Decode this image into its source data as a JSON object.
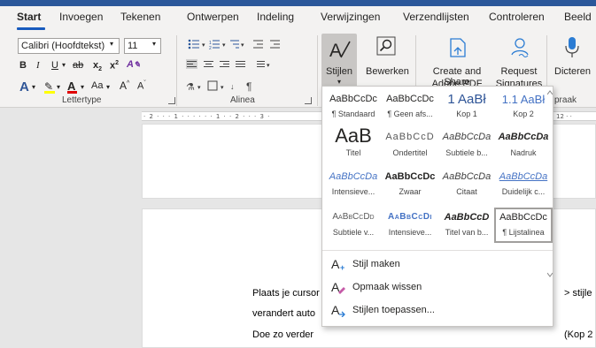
{
  "tabs": [
    "Start",
    "Invoegen",
    "Tekenen",
    "Ontwerpen",
    "Indeling",
    "Verwijzingen",
    "Verzendlijsten",
    "Controleren",
    "Beeld"
  ],
  "font": {
    "name": "Calibri (Hoofdtekst)",
    "size": "11",
    "increase": "A",
    "decrease": "A",
    "case": "Aa"
  },
  "format_buttons": {
    "bold": "B",
    "italic": "I",
    "underline": "U",
    "strike": "ab",
    "subscript": "x",
    "superscript": "x"
  },
  "groups": {
    "lettertype": "Lettertype",
    "alinea": "Alinea",
    "spraak_partial": "praak"
  },
  "buttons": {
    "stijlen": "Stijlen",
    "bewerken": "Bewerken",
    "create_share_1": "Create and Share",
    "create_share_2": "Adobe PDF",
    "request_1": "Request",
    "request_2": "Signatures",
    "dicteren": "Dicteren"
  },
  "ruler": {
    "left": "· 2 · · · 1 · · ·   · · · 1 ·  · 2 · · · 3 ·",
    "right": "12 ·  ·"
  },
  "styles": [
    {
      "sample": "AaBbCcDc",
      "name": "¶ Standaard"
    },
    {
      "sample": "AaBbCcDc",
      "name": "¶ Geen afs..."
    },
    {
      "sample": "1 AaBł",
      "name": "Kop 1"
    },
    {
      "sample": "1.1 AaBł",
      "name": "Kop 2"
    },
    {
      "sample": "AaB",
      "name": "Titel"
    },
    {
      "sample": "AaBbCcD",
      "name": "Ondertitel"
    },
    {
      "sample": "AaBbCcDa",
      "name": "Subtiele b..."
    },
    {
      "sample": "AaBbCcDa",
      "name": "Nadruk"
    },
    {
      "sample": "AaBbCcDa",
      "name": "Intensieve..."
    },
    {
      "sample": "AaBbCcDc",
      "name": "Zwaar"
    },
    {
      "sample": "AaBbCcDa",
      "name": "Citaat"
    },
    {
      "sample": "AaBbCcDa",
      "name": "Duidelijk c..."
    },
    {
      "sample": "AaBbCcDd",
      "name": "Subtiele v..."
    },
    {
      "sample": "AaBbCcDi",
      "name": "Intensieve..."
    },
    {
      "sample": "AaBbCcD",
      "name": "Titel van b..."
    },
    {
      "sample": "AaBbCcDc",
      "name": "¶ Lijstalinea"
    }
  ],
  "menu": [
    {
      "label": "Stijl maken",
      "icon": "create-style-icon"
    },
    {
      "label": "Opmaak wissen",
      "icon": "clear-format-icon"
    },
    {
      "label": "Stijlen toepassen...",
      "icon": "apply-styles-icon"
    }
  ],
  "document": {
    "line1_start": "Plaats je cursor",
    "line1_end": "> stijle",
    "line2_start": "verandert auto",
    "line3_start": "Doe zo verder",
    "line3_end": "(Kop 2"
  },
  "colors": {
    "accent": "#2b579a",
    "heading_blue": "#2f5597",
    "link_blue": "#4472c4"
  }
}
